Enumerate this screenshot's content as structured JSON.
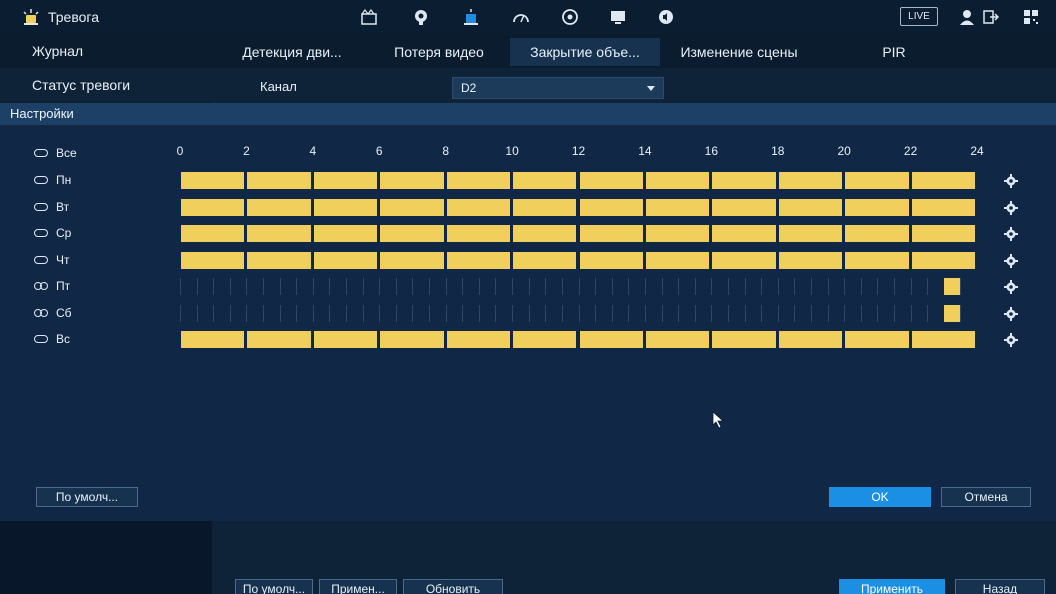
{
  "window": {
    "title": "Тревога",
    "live_label": "LIVE"
  },
  "toolbar_icons": [
    "camera-clapper-icon",
    "ai-head-icon",
    "alarm-icon",
    "performance-icon",
    "disk-icon",
    "monitor-icon",
    "audio-icon"
  ],
  "right_icons": [
    "user-icon",
    "logout-icon",
    "qrcode-icon"
  ],
  "sidebar": {
    "items": [
      {
        "label": "Журнал",
        "active": false
      },
      {
        "label": "Статус тревоги",
        "active": true
      }
    ]
  },
  "tabs": [
    {
      "label": "Детекция дви..."
    },
    {
      "label": "Потеря видео"
    },
    {
      "label": "Закрытие объе...",
      "active": true
    },
    {
      "label": "Изменение сцены"
    },
    {
      "label": "PIR"
    }
  ],
  "channel": {
    "label": "Канал",
    "value": "D2"
  },
  "settings": {
    "header": "Настройки",
    "hours": [
      "0",
      "2",
      "4",
      "6",
      "8",
      "10",
      "12",
      "14",
      "16",
      "18",
      "20",
      "22",
      "24"
    ],
    "all_label": "Все",
    "days": [
      {
        "label": "Пн",
        "linked": false,
        "full": true
      },
      {
        "label": "Вт",
        "linked": false,
        "full": true
      },
      {
        "label": "Ср",
        "linked": false,
        "full": true
      },
      {
        "label": "Чт",
        "linked": false,
        "full": true
      },
      {
        "label": "Пт",
        "linked": true,
        "full": false
      },
      {
        "label": "Сб",
        "linked": true,
        "full": false
      },
      {
        "label": "Вс",
        "linked": false,
        "full": true
      }
    ],
    "partial_block_hours": [
      23,
      23.5
    ]
  },
  "buttons": {
    "default": "По умолч...",
    "ok": "OK",
    "cancel": "Отмена"
  },
  "footer": {
    "default": "По умолч...",
    "apply_short": "Примен...",
    "refresh": "Обновить",
    "apply": "Применить",
    "back": "Назад"
  },
  "colors": {
    "schedule": "#f0cf5c",
    "primary": "#1a8fe3"
  }
}
